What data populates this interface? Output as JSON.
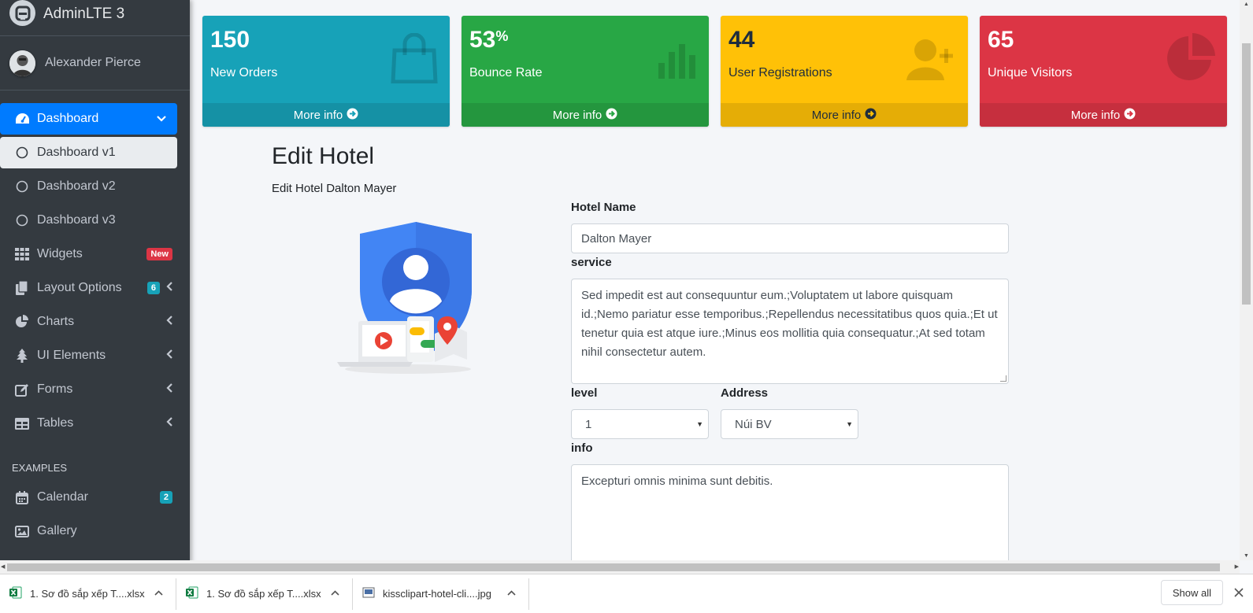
{
  "brand": {
    "name": "AdminLTE 3"
  },
  "user": {
    "name": "Alexander Pierce"
  },
  "sidebar": {
    "items": [
      {
        "label": "Dashboard"
      },
      {
        "label": "Dashboard v1"
      },
      {
        "label": "Dashboard v2"
      },
      {
        "label": "Dashboard v3"
      },
      {
        "label": "Widgets",
        "badge": "New"
      },
      {
        "label": "Layout Options",
        "badge": "6"
      },
      {
        "label": "Charts"
      },
      {
        "label": "UI Elements"
      },
      {
        "label": "Forms"
      },
      {
        "label": "Tables"
      }
    ],
    "header": "EXAMPLES",
    "examples": [
      {
        "label": "Calendar",
        "badge": "2"
      },
      {
        "label": "Gallery"
      }
    ]
  },
  "boxes": [
    {
      "value": "150",
      "sup": "",
      "label": "New Orders",
      "more": "More info",
      "color": "#17a2b8",
      "footer_color": "#1591a5"
    },
    {
      "value": "53",
      "sup": "%",
      "label": "Bounce Rate",
      "more": "More info",
      "color": "#28a745",
      "footer_color": "#24963e"
    },
    {
      "value": "44",
      "sup": "",
      "label": "User Registrations",
      "more": "More info",
      "color": "#ffc107",
      "footer_color": "#e5ad06"
    },
    {
      "value": "65",
      "sup": "",
      "label": "Unique Visitors",
      "more": "More info",
      "color": "#dc3545",
      "footer_color": "#c62f3e"
    }
  ],
  "form": {
    "title": "Edit Hotel",
    "subtitle": "Edit Hotel Dalton Mayer",
    "hotel_name_label": "Hotel Name",
    "hotel_name_value": "Dalton Mayer",
    "service_label": "service",
    "service_value": "Sed impedit est aut consequuntur eum.;Voluptatem ut labore quisquam id.;Nemo pariatur esse temporibus.;Repellendus necessitatibus quos quia.;Et ut tenetur quia est atque iure.;Minus eos mollitia quia consequatur.;At sed totam nihil consectetur autem.",
    "level_label": "level",
    "level_value": "1",
    "address_label": "Address",
    "address_value": "Núi BV",
    "info_label": "info",
    "info_value": "Excepturi omnis minima sunt debitis."
  },
  "downloads": {
    "items": [
      {
        "name": "1. Sơ đồ sắp xếp T....xlsx"
      },
      {
        "name": "1. Sơ đồ sắp xếp T....xlsx"
      },
      {
        "name": "kissclipart-hotel-cli....jpg"
      }
    ],
    "show_all": "Show all"
  }
}
